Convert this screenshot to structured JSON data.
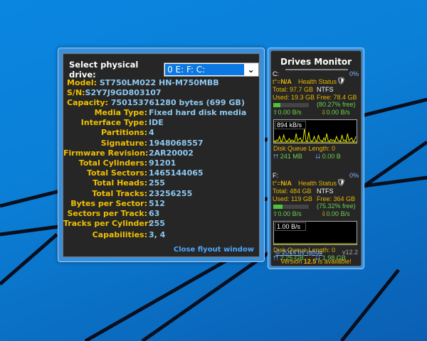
{
  "flyout": {
    "select_label": "Select physical drive:",
    "selected_drive": "0 E: F: C:",
    "model_label": "Model:",
    "model": "ST750LM022 HN-M750MBB",
    "sn_label": "S/N:",
    "sn": "S2Y7J9GD803107",
    "capacity_label": "Capacity:",
    "capacity": "750153761280 bytes  (699 GB)",
    "fields": [
      {
        "label": "Media Type:",
        "value": "Fixed hard disk media"
      },
      {
        "label": "Interface Type:",
        "value": "IDE"
      },
      {
        "label": "Partitions:",
        "value": "4"
      },
      {
        "label": "Signature:",
        "value": "1948068557"
      },
      {
        "label": "Firmware Revision:",
        "value": "2AR20002"
      },
      {
        "label": "Total Cylinders:",
        "value": "91201"
      },
      {
        "label": "Total Sectors:",
        "value": "1465144065"
      },
      {
        "label": "Total Heads:",
        "value": "255"
      },
      {
        "label": "Total Tracks:",
        "value": "23256255"
      },
      {
        "label": "Bytes per Sector:",
        "value": "512"
      },
      {
        "label": "Sectors per Track:",
        "value": "63"
      },
      {
        "label": "Tracks per Cylinder:",
        "value": "255"
      },
      {
        "label": "Capabilities:",
        "value": "3, 4"
      }
    ],
    "close_link": "Close flyout window"
  },
  "gadget": {
    "title": "Drives Monitor",
    "drives": [
      {
        "letter": "C:",
        "percent": "0%",
        "temp_label": "t°=",
        "temp": "N/A",
        "health": "Health Status",
        "total": "Total: 97.7 GB",
        "fs": "NTFS",
        "used": "Used: 19.3 GB",
        "free": "Free: 78.4 GB",
        "free_pct": "(80.27% free)",
        "used_fraction": 0.2,
        "up": "0.00 B/s",
        "down": "0.00 B/s",
        "graph_label": "894 kB/s",
        "queue": "Disk Queue Length: 0",
        "read_total": "241 MB",
        "write_total": "0.00 B"
      },
      {
        "letter": "F:",
        "percent": "0%",
        "temp_label": "t°=",
        "temp": "N/A",
        "health": "Health Status",
        "total": "Total: 484 GB",
        "fs": "NTFS",
        "used": "Used: 119 GB",
        "free": "Free: 364 GB",
        "free_pct": "(75.32% free)",
        "used_fraction": 0.25,
        "up": "0.00 B/s",
        "down": "0.00 B/s",
        "graph_label": "1.00 B/s",
        "queue": "Disk Queue Length: 0",
        "read_total": "2.25 GB",
        "write_total": "1.98 GB"
      }
    ],
    "copyright": "© 2014 by Igogo",
    "version": "v12.2",
    "update_pre": "Version ",
    "update_ver": "12.5",
    "update_post": " is available!"
  }
}
